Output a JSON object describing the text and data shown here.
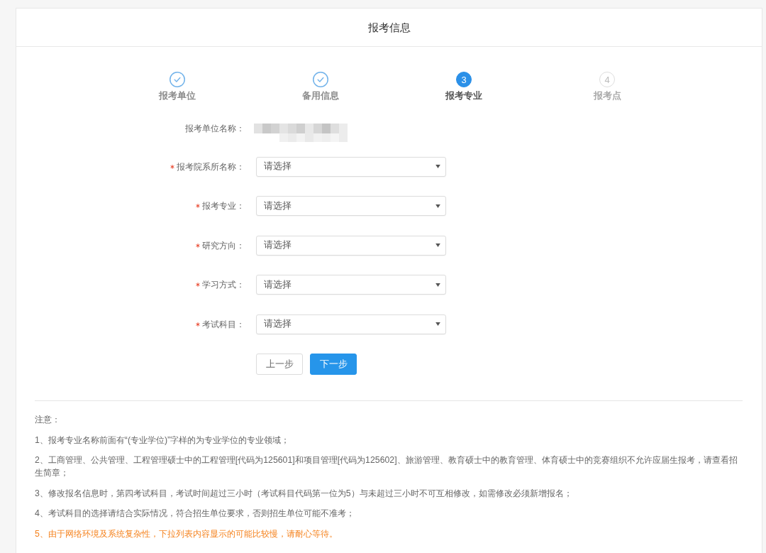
{
  "header": {
    "title": "报考信息"
  },
  "steps": [
    {
      "label": "报考单位",
      "done": true,
      "selected": false
    },
    {
      "label": "备用信息",
      "done": true,
      "selected": false
    },
    {
      "label": "报考专业",
      "done": false,
      "selected": true,
      "number": "3"
    },
    {
      "label": "报考点",
      "done": false,
      "selected": false,
      "number": "4"
    }
  ],
  "form": {
    "fields": [
      {
        "kind": "display",
        "label": "报考单位名称：",
        "required": false
      },
      {
        "kind": "select",
        "label": "报考院系所名称：",
        "required": true,
        "placeholder": "请选择"
      },
      {
        "kind": "select",
        "label": "报考专业：",
        "required": true,
        "placeholder": "请选择"
      },
      {
        "kind": "select",
        "label": "研究方向：",
        "required": true,
        "placeholder": "请选择"
      },
      {
        "kind": "select",
        "label": "学习方式：",
        "required": true,
        "placeholder": "请选择"
      },
      {
        "kind": "select",
        "label": "考试科目：",
        "required": true,
        "placeholder": "请选择"
      }
    ],
    "buttons": [
      {
        "label": "上一步",
        "kind": "default"
      },
      {
        "label": "下一步",
        "kind": "primary"
      }
    ]
  },
  "notes": {
    "title": "注意：",
    "items": [
      {
        "kind": "plain",
        "text": "1、报考专业名称前面有“(专业学位)”字样的为专业学位的专业领域；"
      },
      {
        "kind": "plain",
        "text": "2、工商管理、公共管理、工程管理硕士中的工程管理[代码为125601]和项目管理[代码为125602]、旅游管理、教育硕士中的教育管理、体育硕士中的竞赛组织不允许应届生报考，请查看招生简章；"
      },
      {
        "kind": "plain",
        "text": "3、修改报名信息时，第四考试科目，考试时间超过三小时（考试科目代码第一位为5）与未超过三小时不可互相修改，如需修改必须新增报名；"
      },
      {
        "kind": "plain",
        "text": "4、考试科目的选择请结合实际情况，符合招生单位要求，否则招生单位可能不准考；"
      },
      {
        "kind": "warning",
        "text": "5、由于网络环境及系统复杂性，下拉列表内容显示的可能比较慢，请耐心等待。"
      }
    ]
  }
}
